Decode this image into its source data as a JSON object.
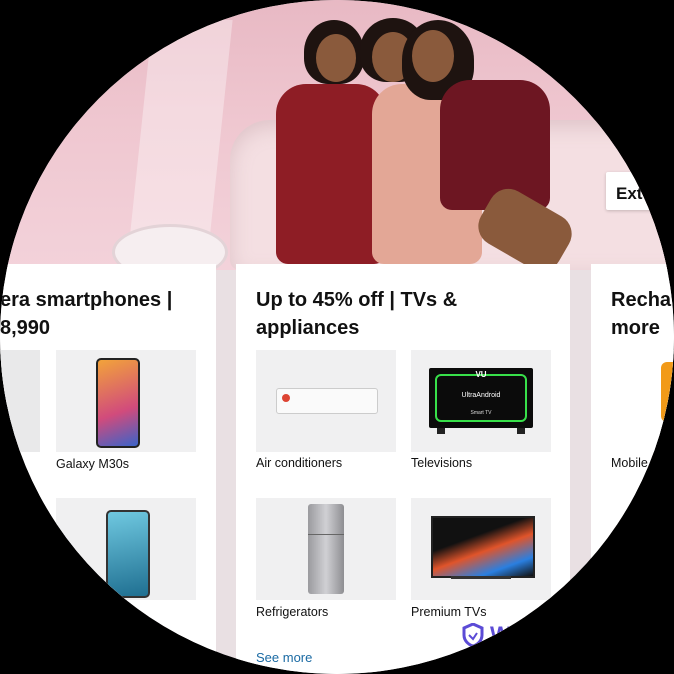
{
  "hero": {
    "cta_label": "Ext"
  },
  "cards": [
    {
      "title_line1": "era smartphones |",
      "title_line2": "8,990",
      "tiles": [
        {
          "label": ""
        },
        {
          "label": "Galaxy M30s"
        },
        {
          "label": ""
        },
        {
          "label": ""
        }
      ]
    },
    {
      "title_line1": "Up to 45% off | TVs &",
      "title_line2": "appliances",
      "tiles": [
        {
          "label": "Air conditioners"
        },
        {
          "label": "Televisions"
        },
        {
          "label": "Refrigerators"
        },
        {
          "label": "Premium TVs"
        }
      ],
      "see_more": "See more"
    },
    {
      "title_line1": "Recha",
      "title_line2": "more",
      "tiles": [
        {
          "label": "Mobile"
        }
      ]
    }
  ],
  "tv_brand": "VU",
  "tv_screen_text": "UltraAndroid",
  "tv_sub_text": "Smart TV",
  "watermark": "Watermarkly",
  "colors": {
    "hero_bg": "#efc7d0",
    "link": "#1a6aa3",
    "watermark": "#5b4bd6"
  }
}
